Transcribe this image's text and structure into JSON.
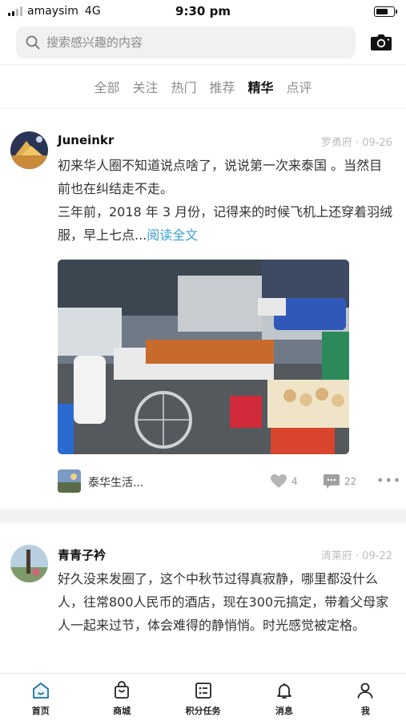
{
  "status_bar": {
    "carrier": "amaysim",
    "network": "4G",
    "time": "9:30 pm",
    "battery_level": 0.7
  },
  "search": {
    "placeholder": "搜索感兴趣的内容"
  },
  "tabs": [
    {
      "label": "全部",
      "active": false
    },
    {
      "label": "关注",
      "active": false
    },
    {
      "label": "热门",
      "active": false
    },
    {
      "label": "推荐",
      "active": false
    },
    {
      "label": "精华",
      "active": true
    },
    {
      "label": "点评",
      "active": false
    }
  ],
  "posts": [
    {
      "author": "Juneinkr",
      "location": "罗勇府",
      "date": "09-26",
      "meta": "罗勇府 · 09-26",
      "paragraph1": "初来华人圈不知道说点啥了，说说第一次来泰国 。当然目前也在纠结走不走。",
      "paragraph2": "三年前，2018 年 3 月份，记得来的时候飞机上还穿着羽绒服，早上七点...",
      "read_more": "阅读全文",
      "circle_name": "泰华生活...",
      "likes": "4",
      "comments": "22"
    },
    {
      "author": "青青子衿",
      "location": "清莱府",
      "date": "09-22",
      "meta": "清莱府 · 09-22",
      "paragraph1": "好久没来发圈了，这个中秋节过得真寂静，哪里都没什么人，往常800人民币的酒店，现在300元搞定，带着父母家人一起来过节，体会难得的静悄悄。时光感觉被定格。"
    }
  ],
  "bottom_nav": [
    {
      "label": "首页",
      "icon": "home-icon"
    },
    {
      "label": "商城",
      "icon": "shopping-bag-icon"
    },
    {
      "label": "积分任务",
      "icon": "task-list-icon"
    },
    {
      "label": "消息",
      "icon": "bell-icon"
    },
    {
      "label": "我",
      "icon": "user-icon"
    }
  ],
  "colors": {
    "accent": "#3aa0d6",
    "active_tab": "#111111",
    "inactive_tab": "#8c8c8c",
    "meta_text": "#bdbdbd"
  }
}
